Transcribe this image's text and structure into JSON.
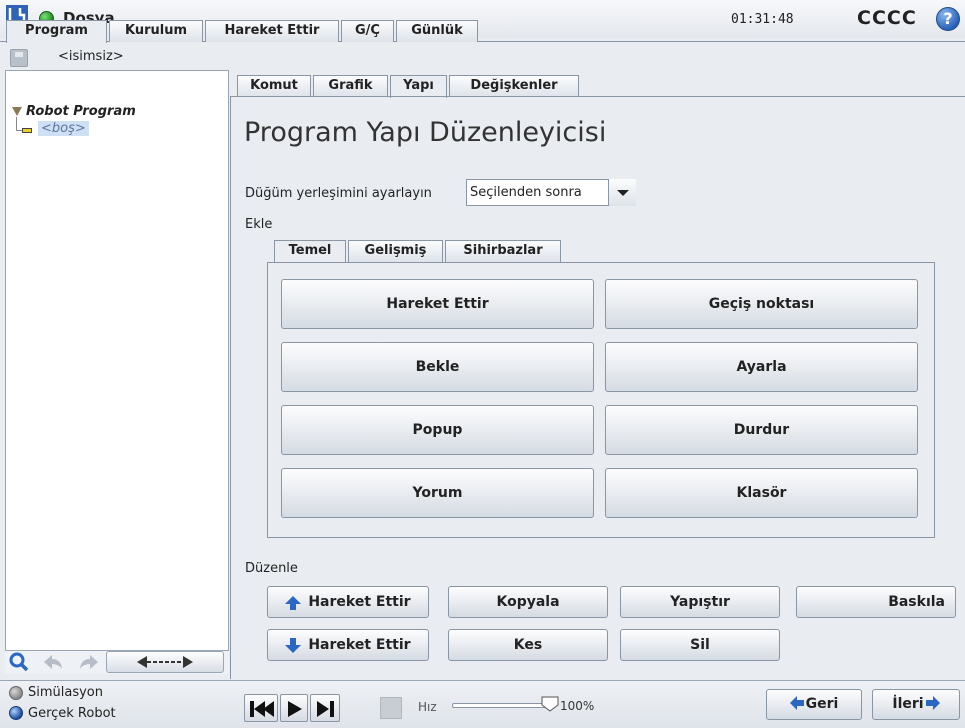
{
  "header": {
    "app_title": "Dosya",
    "clock": "01:31:48",
    "robot_name": "CCCC",
    "help_glyph": "?"
  },
  "top_tabs": [
    "Program",
    "Kurulum",
    "Hareket Ettir",
    "G/Ç",
    "Günlük"
  ],
  "active_top_tab": "Program",
  "file": {
    "name": "<isimsiz>"
  },
  "tree": {
    "root": "Robot Program",
    "child": "<boş>"
  },
  "sub_tabs": [
    "Komut",
    "Grafik",
    "Yapı",
    "Değişkenler"
  ],
  "active_sub_tab": "Yapı",
  "editor": {
    "title": "Program Yapı Düzenleyicisi",
    "placement_label": "Düğüm yerleşimini ayarlayın",
    "placement_value": "Seçilenden sonra",
    "add_label": "Ekle",
    "edit_label": "Düzenle"
  },
  "insert_tabs": [
    "Temel",
    "Gelişmiş",
    "Sihirbazlar"
  ],
  "active_insert_tab": "Temel",
  "insert_buttons": [
    "Hareket Ettir",
    "Geçiş noktası",
    "Bekle",
    "Ayarla",
    "Popup",
    "Durdur",
    "Yorum",
    "Klasör"
  ],
  "edit_buttons": {
    "move_up": "Hareket Ettir",
    "copy": "Kopyala",
    "paste": "Yapıştır",
    "suppress": "Baskıla",
    "move_down": "Hareket Ettir",
    "cut": "Kes",
    "delete": "Sil"
  },
  "footer": {
    "simulation": "Simülasyon",
    "real_robot": "Gerçek Robot",
    "speed_label": "Hız",
    "speed_value": "100%",
    "speed_fraction": 1.0,
    "back": "Geri",
    "next": "İleri"
  },
  "colors": {
    "accent_blue": "#2a66c2",
    "status_green": "#1d8a1d"
  },
  "icons": [
    "ur-logo-icon",
    "status-dot-icon",
    "help-icon",
    "save-icon",
    "search-icon",
    "undo-icon",
    "redo-icon",
    "drag-arrows-icon",
    "skip-start-icon",
    "play-icon",
    "step-icon",
    "stop-icon"
  ]
}
